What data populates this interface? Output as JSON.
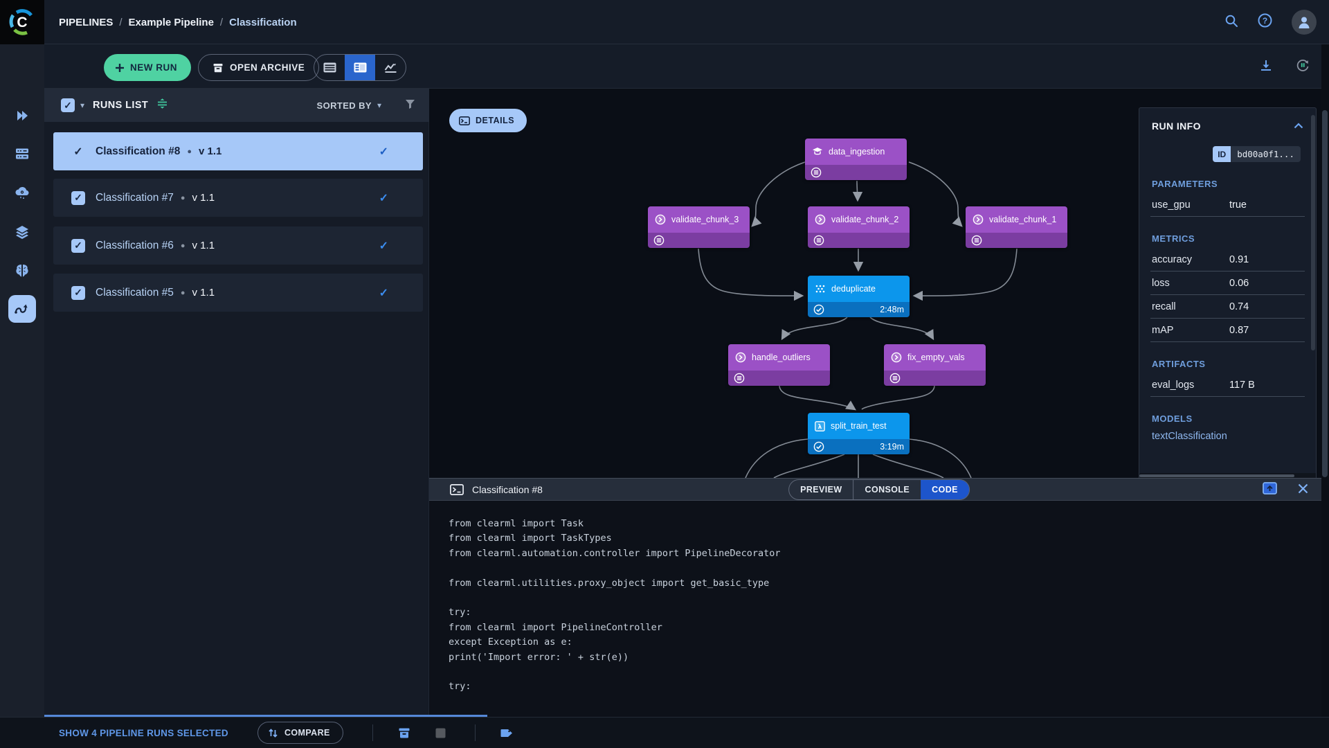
{
  "header": {
    "breadcrumb": {
      "section": "PIPELINES",
      "project": "Example Pipeline",
      "page": "Classification",
      "separator": "/"
    }
  },
  "toolbar": {
    "new_run_label": "NEW RUN",
    "open_archive_label": "OPEN ARCHIVE"
  },
  "runs_list": {
    "title": "RUNS LIST",
    "sorted_by_label": "SORTED BY",
    "bullet": "●",
    "items": [
      {
        "name": "Classification #8",
        "version": "v 1.1",
        "selected": true
      },
      {
        "name": "Classification #7",
        "version": "v 1.1",
        "selected": false
      },
      {
        "name": "Classification #6",
        "version": "v 1.1",
        "selected": false
      },
      {
        "name": "Classification #5",
        "version": "v 1.1",
        "selected": false
      }
    ]
  },
  "graph": {
    "details_label": "DETAILS",
    "nodes": [
      {
        "label": "data_ingestion",
        "status": "completed-cached",
        "color": "purple"
      },
      {
        "label": "validate_chunk_3",
        "status": "completed-cached",
        "color": "purple"
      },
      {
        "label": "validate_chunk_2",
        "status": "completed-cached",
        "color": "purple"
      },
      {
        "label": "validate_chunk_1",
        "status": "completed-cached",
        "color": "purple"
      },
      {
        "label": "deduplicate",
        "status": "completed",
        "color": "blue",
        "duration": "2:48m"
      },
      {
        "label": "handle_outliers",
        "status": "completed-cached",
        "color": "purple"
      },
      {
        "label": "fix_empty_vals",
        "status": "completed-cached",
        "color": "purple"
      },
      {
        "label": "split_train_test",
        "status": "completed",
        "color": "blue",
        "duration": "3:19m"
      }
    ]
  },
  "run_info": {
    "title": "RUN INFO",
    "id_label": "ID",
    "id_value": "bd00a0f1...",
    "sections": {
      "parameters": {
        "title": "PARAMETERS",
        "rows": [
          {
            "label": "use_gpu",
            "value": "true"
          }
        ]
      },
      "metrics": {
        "title": "METRICS",
        "rows": [
          {
            "label": "accuracy",
            "value": "0.91"
          },
          {
            "label": "loss",
            "value": "0.06"
          },
          {
            "label": "recall",
            "value": "0.74"
          },
          {
            "label": "mAP",
            "value": "0.87"
          }
        ]
      },
      "artifacts": {
        "title": "ARTIFACTS",
        "rows": [
          {
            "label": "eval_logs",
            "value": "117 B"
          }
        ]
      },
      "models": {
        "title": "MODELS",
        "rows": [
          {
            "label": "textClassification"
          }
        ]
      }
    }
  },
  "code_panel": {
    "title": "Classification #8",
    "tabs": [
      {
        "label": "PREVIEW"
      },
      {
        "label": "CONSOLE"
      },
      {
        "label": "CODE"
      }
    ],
    "active_tab": "CODE",
    "code": "from clearml import Task\nfrom clearml import TaskTypes\nfrom clearml.automation.controller import PipelineDecorator\n\nfrom clearml.utilities.proxy_object import get_basic_type\n\ntry:\nfrom clearml import PipelineController\nexcept Exception as e:\nprint('Import error: ' + str(e))\n\ntry:"
  },
  "footer": {
    "selection_label": "SHOW 4 PIPELINE RUNS SELECTED",
    "compare_label": "COMPARE"
  },
  "colors": {
    "accent_light_blue": "#a6c8f8",
    "primary_blue": "#2a65cc",
    "code_tab_blue": "#1d55cb",
    "new_run_green": "#4fd2a2",
    "node_purple": "#9b51c6",
    "node_purple_strip": "#7b3da1",
    "node_blue": "#0c96ec",
    "node_blue_strip": "#0a70bf",
    "status_check_blue": "#3b8df0"
  }
}
